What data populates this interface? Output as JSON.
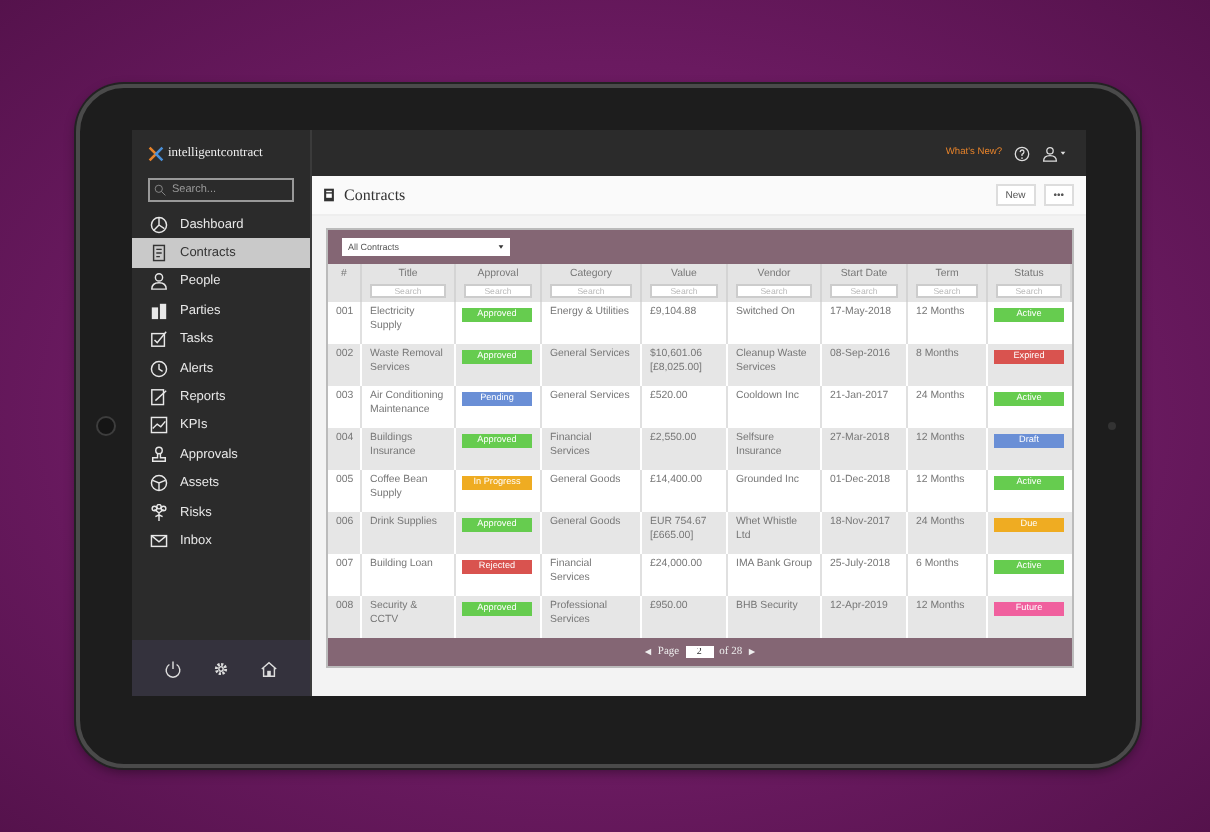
{
  "topbar": {
    "logo": "intelligentcontract",
    "whats_new": "What's New?"
  },
  "sidebar": {
    "search": {
      "placeholder": "Search..."
    },
    "items": [
      {
        "label": "Dashboard",
        "selected": false
      },
      {
        "label": "Contracts",
        "selected": true
      },
      {
        "label": "People",
        "selected": false
      },
      {
        "label": "Parties",
        "selected": false
      },
      {
        "label": "Tasks",
        "selected": false
      },
      {
        "label": "Alerts",
        "selected": false
      },
      {
        "label": "Reports",
        "selected": false
      },
      {
        "label": "KPIs",
        "selected": false
      },
      {
        "label": "Approvals",
        "selected": false
      },
      {
        "label": "Assets",
        "selected": false
      },
      {
        "label": "Risks",
        "selected": false
      },
      {
        "label": "Inbox",
        "selected": false
      }
    ]
  },
  "page": {
    "title": "Contracts",
    "buttons": [
      {
        "label": "New"
      },
      {
        "label": "•••"
      }
    ]
  },
  "table": {
    "filter": "All Contracts",
    "columns": [
      {
        "label": "#"
      },
      {
        "label": "Title",
        "placeholder": "Search"
      },
      {
        "label": "Approval",
        "placeholder": "Search"
      },
      {
        "label": "Category",
        "placeholder": "Search"
      },
      {
        "label": "Value",
        "placeholder": "Search"
      },
      {
        "label": "Vendor",
        "placeholder": "Search"
      },
      {
        "label": "Start Date",
        "placeholder": "Search"
      },
      {
        "label": "Term",
        "placeholder": "Search"
      },
      {
        "label": "Status",
        "placeholder": "Search"
      }
    ],
    "rows": [
      {
        "number": "001",
        "title": "Electricity Supply",
        "approval": {
          "label": "Approved",
          "color": "#66cc4f"
        },
        "category": "Energy & Utilities",
        "value": "£9,104.88",
        "vendor": "Switched On",
        "start_date": "17-May-2018",
        "term": "12 Months",
        "status": {
          "label": "Active",
          "color": "#66cc4f"
        }
      },
      {
        "number": "002",
        "title": "Waste Removal Services",
        "approval": {
          "label": "Approved",
          "color": "#66cc4f"
        },
        "category": "General Services",
        "value": "$10,601.06 [£8,025.00]",
        "vendor": "Cleanup Waste Services",
        "start_date": "08-Sep-2016",
        "term": "8 Months",
        "status": {
          "label": "Expired",
          "color": "#d9534f"
        }
      },
      {
        "number": "003",
        "title": "Air Conditioning Maintenance",
        "approval": {
          "label": "Pending",
          "color": "#6a8fd6"
        },
        "category": "General Services",
        "value": "£520.00",
        "vendor": "Cooldown Inc",
        "start_date": "21-Jan-2017",
        "term": "24 Months",
        "status": {
          "label": "Active",
          "color": "#66cc4f"
        }
      },
      {
        "number": "004",
        "title": "Buildings Insurance",
        "approval": {
          "label": "Approved",
          "color": "#66cc4f"
        },
        "category": "Financial Services",
        "value": "£2,550.00",
        "vendor": "Selfsure Insurance",
        "start_date": "27-Mar-2018",
        "term": "12 Months",
        "status": {
          "label": "Draft",
          "color": "#6a8fd6"
        }
      },
      {
        "number": "005",
        "title": "Coffee Bean Supply",
        "approval": {
          "label": "In Progress",
          "color": "#efac22"
        },
        "category": "General Goods",
        "value": "£14,400.00",
        "vendor": "Grounded Inc",
        "start_date": "01-Dec-2018",
        "term": "12 Months",
        "status": {
          "label": "Active",
          "color": "#66cc4f"
        }
      },
      {
        "number": "006",
        "title": "Drink Supplies",
        "approval": {
          "label": "Approved",
          "color": "#66cc4f"
        },
        "category": "General Goods",
        "value": "EUR 754.67 [£665.00]",
        "vendor": "Whet Whistle Ltd",
        "start_date": "18-Nov-2017",
        "term": "24 Months",
        "status": {
          "label": "Due",
          "color": "#efac22"
        }
      },
      {
        "number": "007",
        "title": "Building Loan",
        "approval": {
          "label": "Rejected",
          "color": "#d9534f"
        },
        "category": "Financial Services",
        "value": "£24,000.00",
        "vendor": "IMA Bank Group",
        "start_date": "25-July-2018",
        "term": "6 Months",
        "status": {
          "label": "Active",
          "color": "#66cc4f"
        }
      },
      {
        "number": "008",
        "title": "Security & CCTV",
        "approval": {
          "label": "Approved",
          "color": "#66cc4f"
        },
        "category": "Professional Services",
        "value": "£950.00",
        "vendor": "BHB Security",
        "start_date": "12-Apr-2019",
        "term": "12 Months",
        "status": {
          "label": "Future",
          "color": "#f0609e"
        }
      }
    ]
  },
  "pagination": {
    "label": "Page",
    "value": "2",
    "total": "of 28"
  }
}
